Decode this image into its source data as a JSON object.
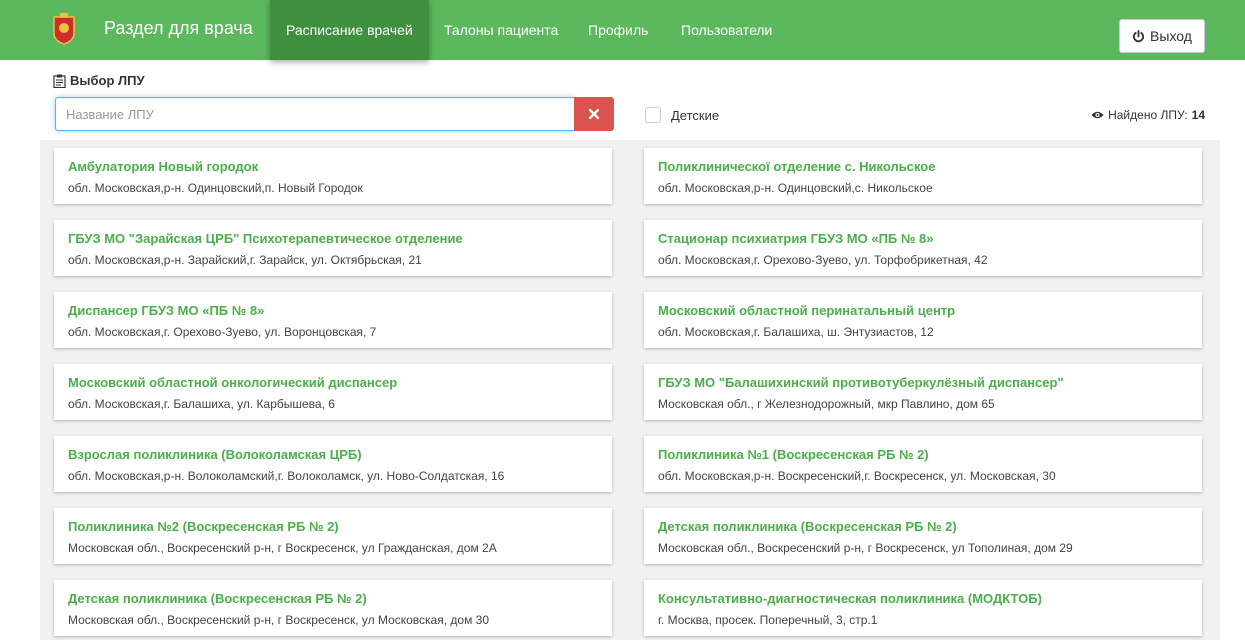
{
  "navbar": {
    "brand": "Раздел для врача",
    "items": [
      "Расписание врачей",
      "Талоны пациента",
      "Профиль",
      "Пользователи"
    ],
    "logout": "Выход"
  },
  "section": {
    "title": "Выбор ЛПУ"
  },
  "search": {
    "placeholder": "Название ЛПУ",
    "value": ""
  },
  "filter": {
    "children_label": "Детские",
    "checked": false
  },
  "found": {
    "label": "Найдено ЛПУ:",
    "count": "14"
  },
  "colors": {
    "primary": "#5cb85c",
    "active": "#3e8f3e",
    "danger": "#d9534f",
    "link": "#4cae4c"
  },
  "cards": [
    {
      "title": "Амбулатория Новый городок",
      "address": "обл. Московская,р-н. Одинцовский,п. Новый Городок"
    },
    {
      "title": "Поликлиническої отделение с. Никольское",
      "address": "обл. Московская,р-н. Одинцовский,с. Никольское"
    },
    {
      "title": "ГБУЗ МО \"Зарайская ЦРБ\" Психотерапевтическое отделение",
      "address": "обл. Московская,р-н. Зарайский,г. Зарайск, ул. Октябрьская, 21"
    },
    {
      "title": "Стационар психиатрия ГБУЗ МО «ПБ № 8»",
      "address": "обл. Московская,г. Орехово-Зуево, ул. Торфобрикетная, 42"
    },
    {
      "title": "Диспансер ГБУЗ МО «ПБ № 8»",
      "address": "обл. Московская,г. Орехово-Зуево, ул. Воронцовская, 7"
    },
    {
      "title": "Московский областной перинатальный центр",
      "address": "обл. Московская,г. Балашиха, ш. Энтузиастов, 12"
    },
    {
      "title": "Московский областной онкологический диспансер",
      "address": "обл. Московская,г. Балашиха, ул. Карбышева, 6"
    },
    {
      "title": "ГБУЗ МО \"Балашихинский противотуберкулёзный диспансер\"",
      "address": "Московская обл., г Железнодорожный, мкр Павлино, дом 65"
    },
    {
      "title": "Взрослая поликлиника (Волоколамская ЦРБ)",
      "address": "обл. Московская,р-н. Волоколамский,г. Волоколамск, ул. Ново-Солдатская, 16"
    },
    {
      "title": "Поликлиника №1 (Воскресенская РБ № 2)",
      "address": "обл. Московская,р-н. Воскресенский,г. Воскресенск, ул. Московская, 30"
    },
    {
      "title": "Поликлиника №2 (Воскресенская РБ № 2)",
      "address": "Московская обл., Воскресенский р-н, г Воскресенск, ул Гражданская, дом 2А"
    },
    {
      "title": "Детская поликлиника (Воскресенская РБ № 2)",
      "address": "Московская обл., Воскресенский р-н, г Воскресенск, ул Тополиная, дом 29"
    },
    {
      "title": "Детская поликлиника (Воскресенская РБ № 2)",
      "address": "Московская обл., Воскресенский р-н, г Воскресенск, ул Московская, дом 30"
    },
    {
      "title": "Консультативно-диагностическая поликлиника (МОДКТОБ)",
      "address": "г. Москва, просек. Поперечный, 3, стр.1"
    }
  ]
}
